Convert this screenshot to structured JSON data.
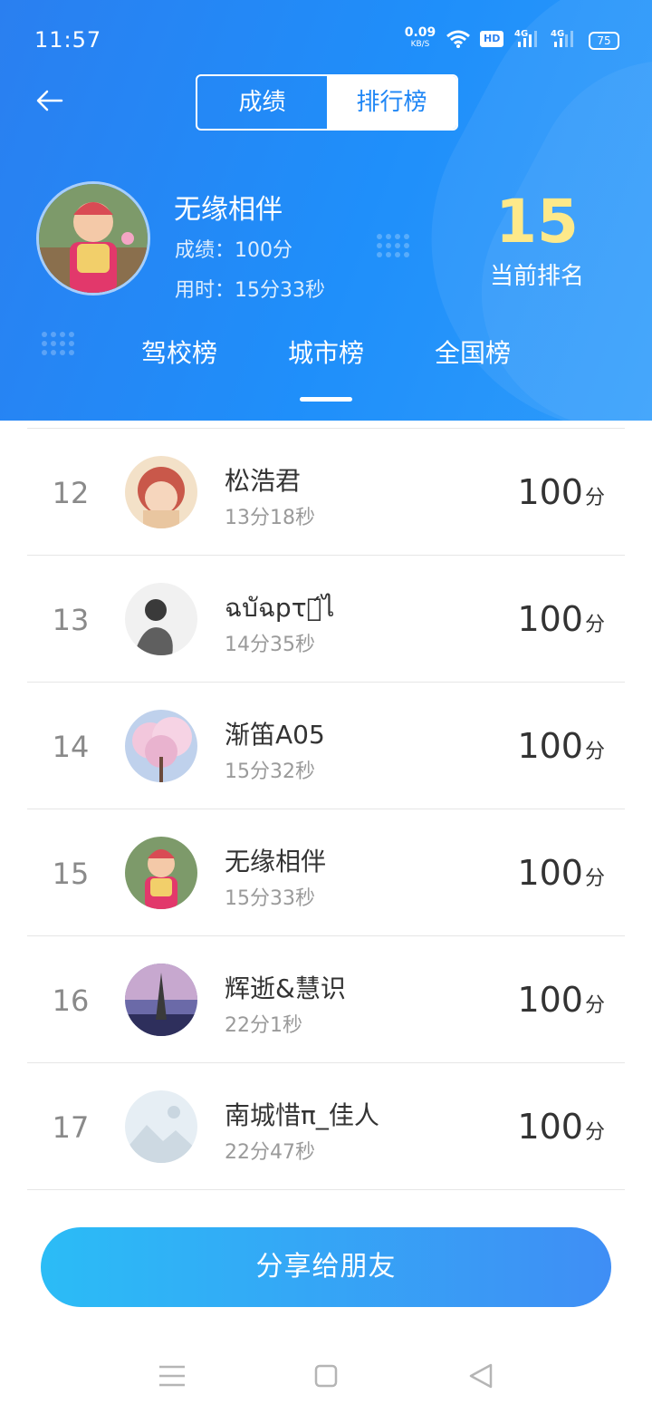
{
  "status_bar": {
    "time": "11:57",
    "net_speed": "0.09",
    "net_unit": "KB/S",
    "hd_label": "HD",
    "sim1": "4G",
    "sim2": "4G",
    "battery": "75"
  },
  "header": {
    "segments": [
      "成绩",
      "排行榜"
    ],
    "active_segment": "排行榜",
    "user": {
      "name": "无缘相伴",
      "score_line": "成绩：100分",
      "time_line": "用时：15分33秒"
    },
    "rank": {
      "number": "15",
      "label": "当前排名"
    },
    "tabs": [
      "驾校榜",
      "城市榜",
      "全国榜"
    ],
    "active_tab": "城市榜"
  },
  "rows": [
    {
      "rank": "12",
      "name": "松浩君",
      "time": "13分18秒",
      "score": "100",
      "unit": "分"
    },
    {
      "rank": "13",
      "name": "ฉบัฉpτช́ไ",
      "time": "14分35秒",
      "score": "100",
      "unit": "分"
    },
    {
      "rank": "14",
      "name": "渐笛A05",
      "time": "15分32秒",
      "score": "100",
      "unit": "分"
    },
    {
      "rank": "15",
      "name": "无缘相伴",
      "time": "15分33秒",
      "score": "100",
      "unit": "分"
    },
    {
      "rank": "16",
      "name": "辉逝&慧识",
      "time": "22分1秒",
      "score": "100",
      "unit": "分"
    },
    {
      "rank": "17",
      "name": "南城惜π_佳人",
      "time": "22分47秒",
      "score": "100",
      "unit": "分"
    }
  ],
  "share_button": "分享给朋友",
  "colors": {
    "header_blue": "#1f8ffa",
    "rank_yellow": "#fde98a",
    "share_start": "#2bbcf6",
    "share_end": "#3f8ef5"
  },
  "icons": {
    "back": "arrow-left-icon",
    "wifi": "wifi-icon",
    "nav_menu": "menu-icon",
    "nav_home": "square-icon",
    "nav_back": "triangle-back-icon"
  }
}
